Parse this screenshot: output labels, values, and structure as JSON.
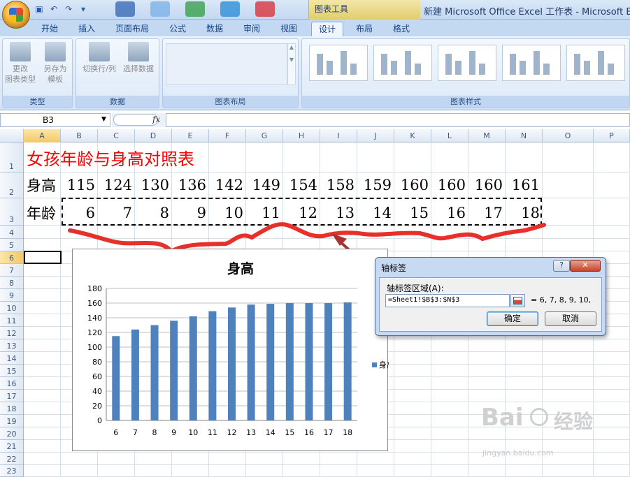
{
  "window": {
    "title": "新建 Microsoft Office Excel 工作表 - Microsoft Excel",
    "context_tools": "图表工具"
  },
  "tabs": [
    "开始",
    "插入",
    "页面布局",
    "公式",
    "数据",
    "审阅",
    "视图",
    "设计",
    "布局",
    "格式"
  ],
  "active_tab": "设计",
  "ribbon": {
    "groups": {
      "type": {
        "label": "类型",
        "buttons": [
          {
            "line1": "更改",
            "line2": "图表类型"
          },
          {
            "line1": "另存为",
            "line2": "模板"
          }
        ]
      },
      "data": {
        "label": "数据",
        "buttons": [
          {
            "line1": "切换行/列",
            "line2": ""
          },
          {
            "line1": "选择数据",
            "line2": ""
          }
        ]
      },
      "layout": {
        "label": "图表布局"
      },
      "styles": {
        "label": "图表样式"
      }
    }
  },
  "formula_bar": {
    "name_box": "B3",
    "fx_label": "fx",
    "formula": ""
  },
  "columns": [
    "A",
    "B",
    "C",
    "D",
    "E",
    "F",
    "G",
    "H",
    "I",
    "J",
    "K",
    "L",
    "M",
    "N",
    "O",
    "P"
  ],
  "rows": [
    "1",
    "2",
    "3",
    "4",
    "5",
    "6",
    "7",
    "8",
    "9",
    "10",
    "11",
    "12",
    "13",
    "14",
    "15",
    "16",
    "17",
    "18",
    "19",
    "20",
    "21",
    "22",
    "23"
  ],
  "sheet": {
    "title": "女孩年龄与身高对照表",
    "row2_label": "身高",
    "heights": [
      "115",
      "124",
      "130",
      "136",
      "142",
      "149",
      "154",
      "158",
      "159",
      "160",
      "160",
      "160",
      "161"
    ],
    "row3_label": "年龄",
    "ages": [
      "6",
      "7",
      "8",
      "9",
      "10",
      "11",
      "12",
      "13",
      "14",
      "15",
      "16",
      "17",
      "18"
    ]
  },
  "chart_data": {
    "type": "bar",
    "title": "身高",
    "categories": [
      "6",
      "7",
      "8",
      "9",
      "10",
      "11",
      "12",
      "13",
      "14",
      "15",
      "16",
      "17",
      "18"
    ],
    "series": [
      {
        "name": "身高",
        "values": [
          115,
          124,
          130,
          136,
          142,
          149,
          154,
          158,
          159,
          160,
          160,
          160,
          161
        ]
      }
    ],
    "ylim": [
      0,
      180
    ],
    "yticks": [
      "0",
      "20",
      "40",
      "60",
      "80",
      "100",
      "120",
      "140",
      "160",
      "180"
    ],
    "grid": true,
    "legend": "right",
    "bar_color": "#4f81bd"
  },
  "dialog": {
    "title": "轴标签",
    "help_label": "?",
    "close_label": "✕",
    "field_label": "轴标签区域(A):",
    "range_value": "=Sheet1!$B$3:$N$3",
    "preview": "= 6, 7, 8, 9, 10,",
    "ok_label": "确定",
    "cancel_label": "取消"
  },
  "watermark": {
    "brand": "Bai",
    "brand2": "经验",
    "url": "jingyan.baidu.com"
  },
  "colors": {
    "title_red": "#ff0000",
    "annotation_red": "#e8302a",
    "ribbon_blue": "#c3d8f1"
  }
}
